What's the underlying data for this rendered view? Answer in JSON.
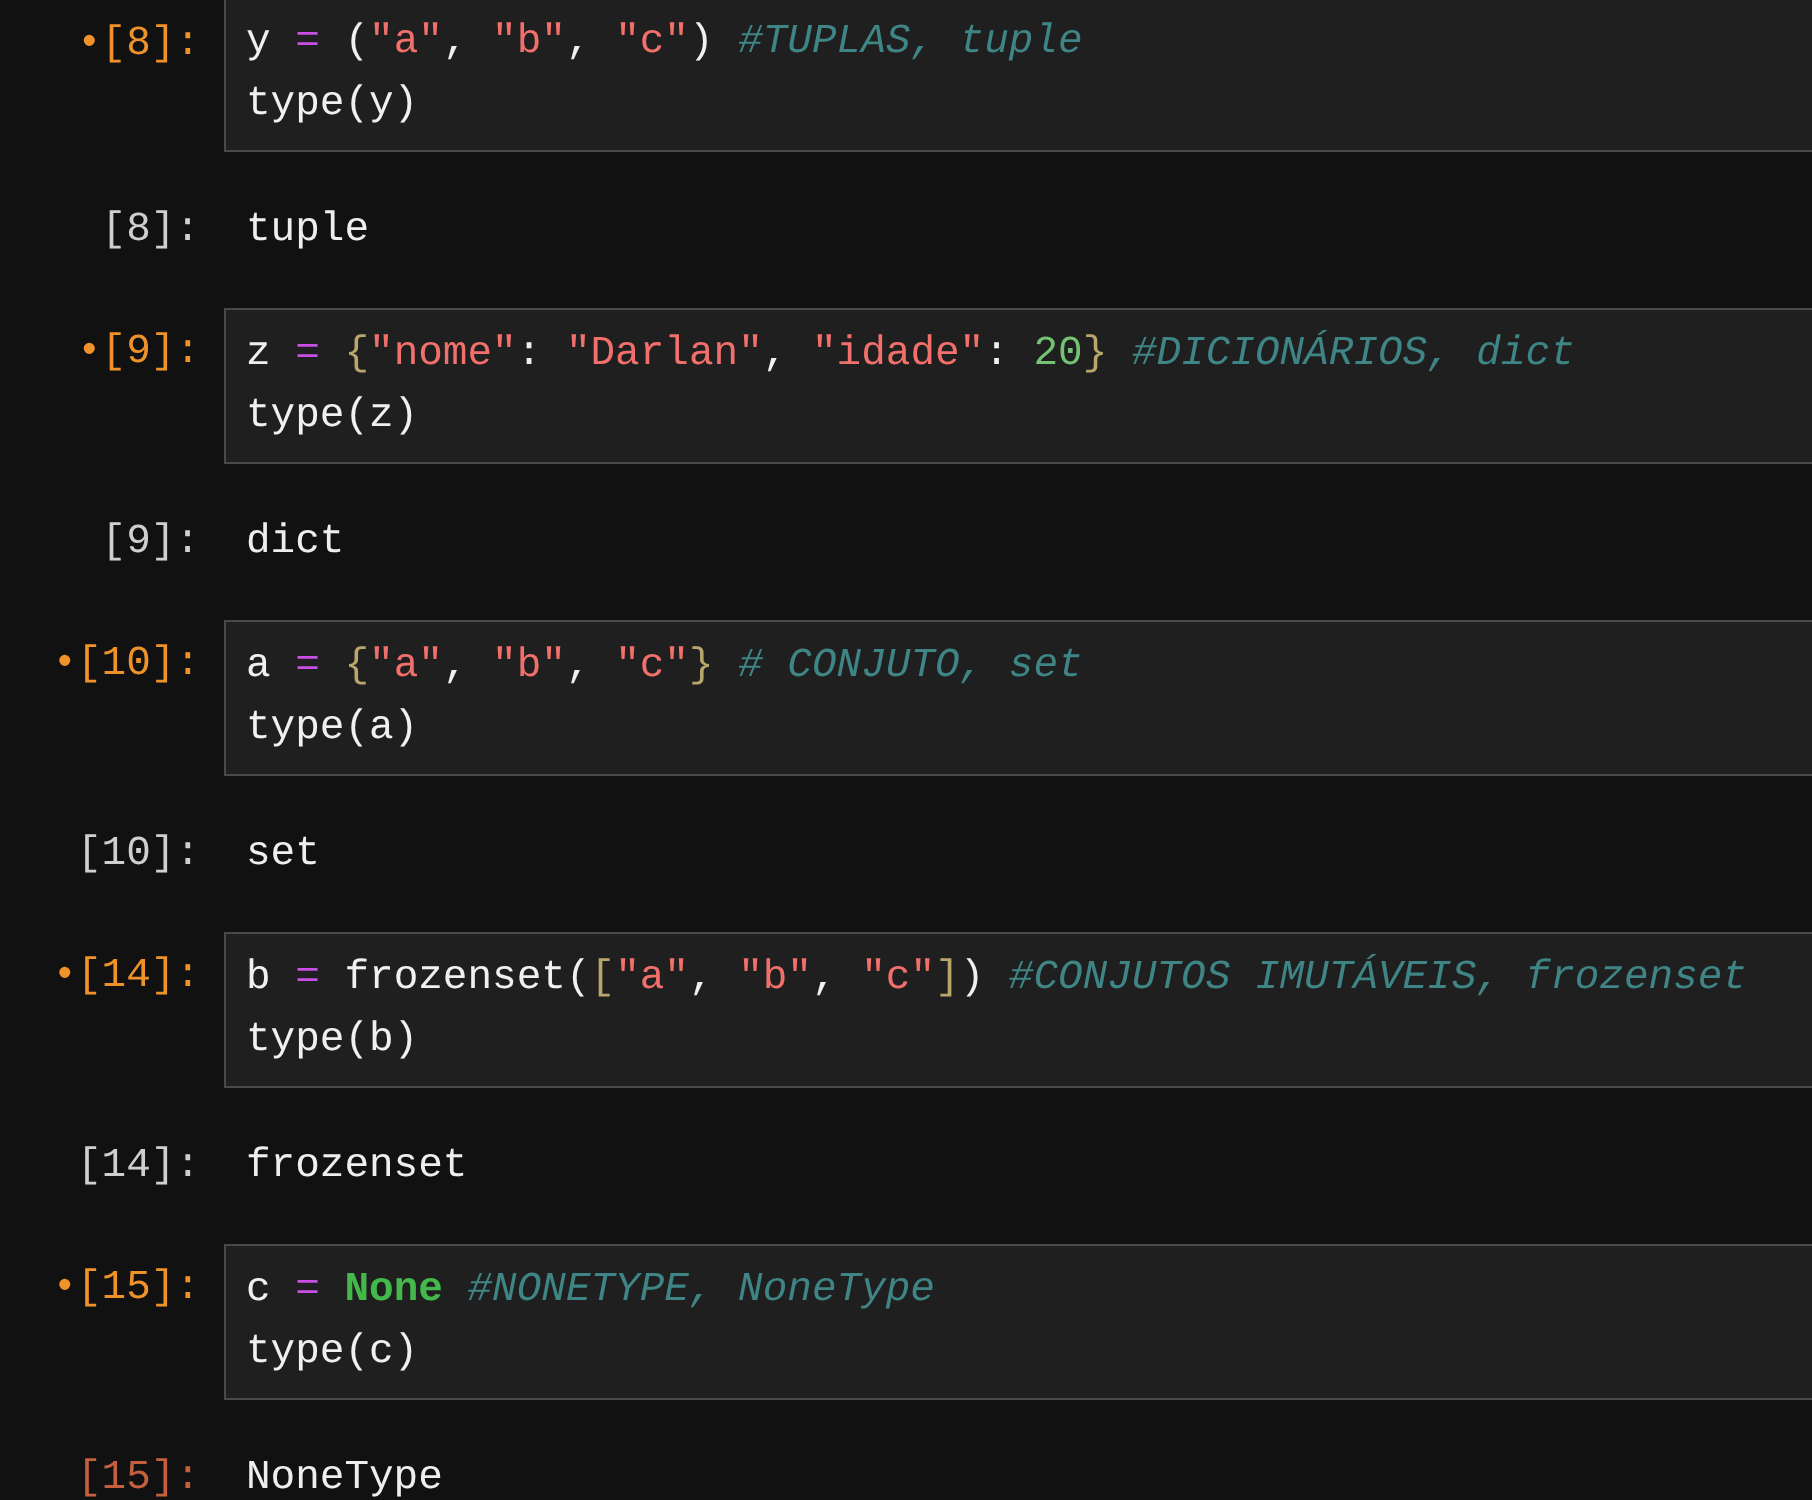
{
  "cells": [
    {
      "prompt": "•[8]:",
      "active": false,
      "output_prompt": "[8]:",
      "output": "tuple",
      "lines": [
        [
          {
            "text": "y ",
            "kind": "name"
          },
          {
            "text": "=",
            "kind": "op"
          },
          {
            "text": " (",
            "kind": "plain"
          },
          {
            "text": "\"a\"",
            "kind": "string"
          },
          {
            "text": ", ",
            "kind": "plain"
          },
          {
            "text": "\"b\"",
            "kind": "string"
          },
          {
            "text": ", ",
            "kind": "plain"
          },
          {
            "text": "\"c\"",
            "kind": "string"
          },
          {
            "text": ") ",
            "kind": "plain"
          },
          {
            "text": "#TUPLAS, tuple",
            "kind": "comment"
          }
        ],
        [
          {
            "text": "type(y)",
            "kind": "plain"
          }
        ]
      ]
    },
    {
      "prompt": "•[9]:",
      "active": false,
      "output_prompt": "[9]:",
      "output": "dict",
      "lines": [
        [
          {
            "text": "z ",
            "kind": "name"
          },
          {
            "text": "= ",
            "kind": "op"
          },
          {
            "text": "{",
            "kind": "brace"
          },
          {
            "text": "\"nome\"",
            "kind": "string"
          },
          {
            "text": ": ",
            "kind": "plain"
          },
          {
            "text": "\"Darlan\"",
            "kind": "string"
          },
          {
            "text": ", ",
            "kind": "plain"
          },
          {
            "text": "\"idade\"",
            "kind": "string"
          },
          {
            "text": ": ",
            "kind": "plain"
          },
          {
            "text": "20",
            "kind": "number"
          },
          {
            "text": "} ",
            "kind": "brace"
          },
          {
            "text": "#DICIONÁRIOS, dict",
            "kind": "comment"
          }
        ],
        [
          {
            "text": "type(z)",
            "kind": "plain"
          }
        ]
      ]
    },
    {
      "prompt": "•[10]:",
      "active": false,
      "output_prompt": "[10]:",
      "output": "set",
      "lines": [
        [
          {
            "text": "a ",
            "kind": "name"
          },
          {
            "text": "= ",
            "kind": "op"
          },
          {
            "text": "{",
            "kind": "brace"
          },
          {
            "text": "\"a\"",
            "kind": "string"
          },
          {
            "text": ", ",
            "kind": "plain"
          },
          {
            "text": "\"b\"",
            "kind": "string"
          },
          {
            "text": ", ",
            "kind": "plain"
          },
          {
            "text": "\"c\"",
            "kind": "string"
          },
          {
            "text": "} ",
            "kind": "brace"
          },
          {
            "text": "# CONJUTO, set",
            "kind": "comment"
          }
        ],
        [
          {
            "text": "type(a)",
            "kind": "plain"
          }
        ]
      ]
    },
    {
      "prompt": "•[14]:",
      "active": false,
      "output_prompt": "[14]:",
      "output": "frozenset",
      "lines": [
        [
          {
            "text": "b ",
            "kind": "name"
          },
          {
            "text": "=",
            "kind": "op"
          },
          {
            "text": " frozenset(",
            "kind": "plain"
          },
          {
            "text": "[",
            "kind": "brace"
          },
          {
            "text": "\"a\"",
            "kind": "string"
          },
          {
            "text": ", ",
            "kind": "plain"
          },
          {
            "text": "\"b\"",
            "kind": "string"
          },
          {
            "text": ", ",
            "kind": "plain"
          },
          {
            "text": "\"c\"",
            "kind": "string"
          },
          {
            "text": "]",
            "kind": "brace"
          },
          {
            "text": ") ",
            "kind": "plain"
          },
          {
            "text": "#CONJUTOS IMUTÁVEIS, frozenset",
            "kind": "comment"
          }
        ],
        [
          {
            "text": "type(b)",
            "kind": "plain"
          }
        ]
      ]
    },
    {
      "prompt": "•[15]:",
      "active": true,
      "output_prompt": "[15]:",
      "output": "NoneType",
      "lines": [
        [
          {
            "text": "c ",
            "kind": "name"
          },
          {
            "text": "= ",
            "kind": "op"
          },
          {
            "text": "None ",
            "kind": "keyword"
          },
          {
            "text": "#NONETYPE, NoneType",
            "kind": "comment"
          }
        ],
        [
          {
            "text": "type(c)",
            "kind": "plain"
          }
        ]
      ]
    }
  ]
}
